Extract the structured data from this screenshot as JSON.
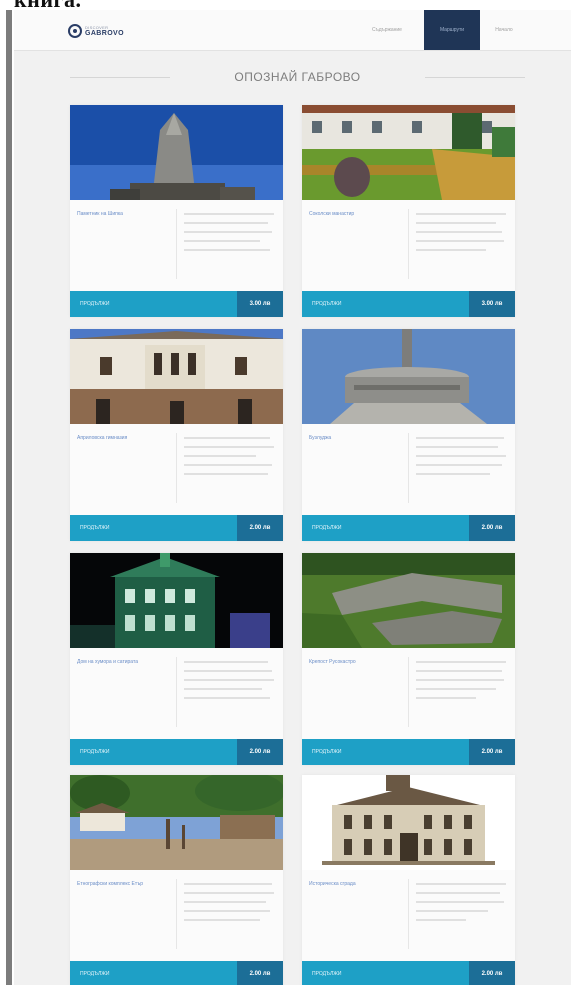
{
  "header_clip": "книга.",
  "nav": {
    "logo_tag": "DISCOVER",
    "logo_name": "GABROVO",
    "items": [
      "Съдържание",
      "Маршрути",
      "Начало"
    ]
  },
  "page_title": "ОПОЗНАЙ ГАБРОВО",
  "cards": [
    {
      "name": "Паметник на Шипка",
      "photo": "shipka-monument-photo",
      "button": "ПРОДЪЛЖИ",
      "price": "3.00 лв"
    },
    {
      "name": "Соколски манастир",
      "photo": "monastery-garden-photo",
      "button": "ПРОДЪЛЖИ",
      "price": "3.00 лв"
    },
    {
      "name": "Априловска гимназия",
      "photo": "school-facade-photo",
      "button": "ПРОДЪЛЖИ",
      "price": "2.00 лв"
    },
    {
      "name": "Бузлуджа",
      "photo": "buzludzha-monument-photo",
      "button": "ПРОДЪЛЖИ",
      "price": "2.00 лв"
    },
    {
      "name": "Дом на хумора и сатирата",
      "photo": "illuminated-house-photo",
      "button": "ПРОДЪЛЖИ",
      "price": "2.00 лв"
    },
    {
      "name": "Крепост Русокастро",
      "photo": "fortress-ruins-photo",
      "button": "ПРОДЪЛЖИ",
      "price": "2.00 лв"
    },
    {
      "name": "Етнографски комплекс Етър",
      "photo": "village-square-photo",
      "button": "ПРОДЪЛЖИ",
      "price": "2.00 лв"
    },
    {
      "name": "Историческа сграда",
      "photo": "historic-building-photo",
      "button": "ПРОДЪЛЖИ",
      "price": "2.00 лв"
    }
  ]
}
